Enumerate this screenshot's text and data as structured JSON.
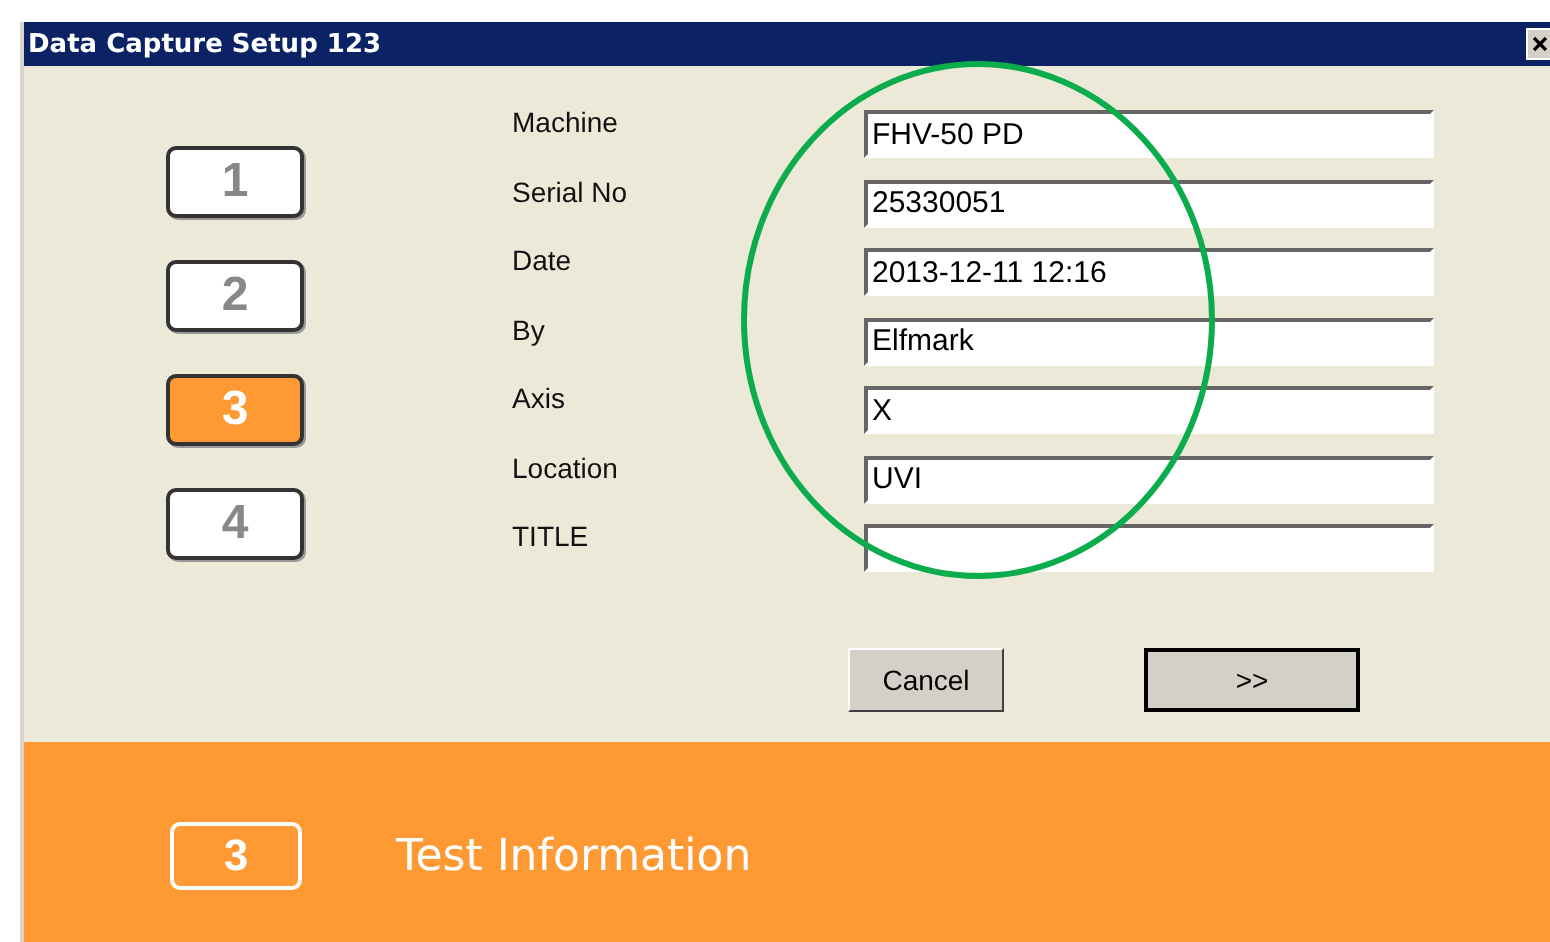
{
  "window": {
    "title": "Data Capture Setup 123"
  },
  "steps": [
    {
      "label": "1",
      "selected": false
    },
    {
      "label": "2",
      "selected": false
    },
    {
      "label": "3",
      "selected": true
    },
    {
      "label": "4",
      "selected": false
    }
  ],
  "fields": [
    {
      "label": "Machine",
      "value": "FHV-50 PD"
    },
    {
      "label": "Serial No",
      "value": "25330051"
    },
    {
      "label": "Date",
      "value": "2013-12-11 12:16"
    },
    {
      "label": "By",
      "value": "Elfmark"
    },
    {
      "label": "Axis",
      "value": "X"
    },
    {
      "label": "Location",
      "value": "UVI"
    },
    {
      "label": "TITLE"
    }
  ],
  "buttons": [
    {
      "label": "Cancel",
      "default": false
    },
    {
      "label": ">>",
      "default": true
    }
  ],
  "footer": {
    "step": "3",
    "title": "Test Information"
  }
}
